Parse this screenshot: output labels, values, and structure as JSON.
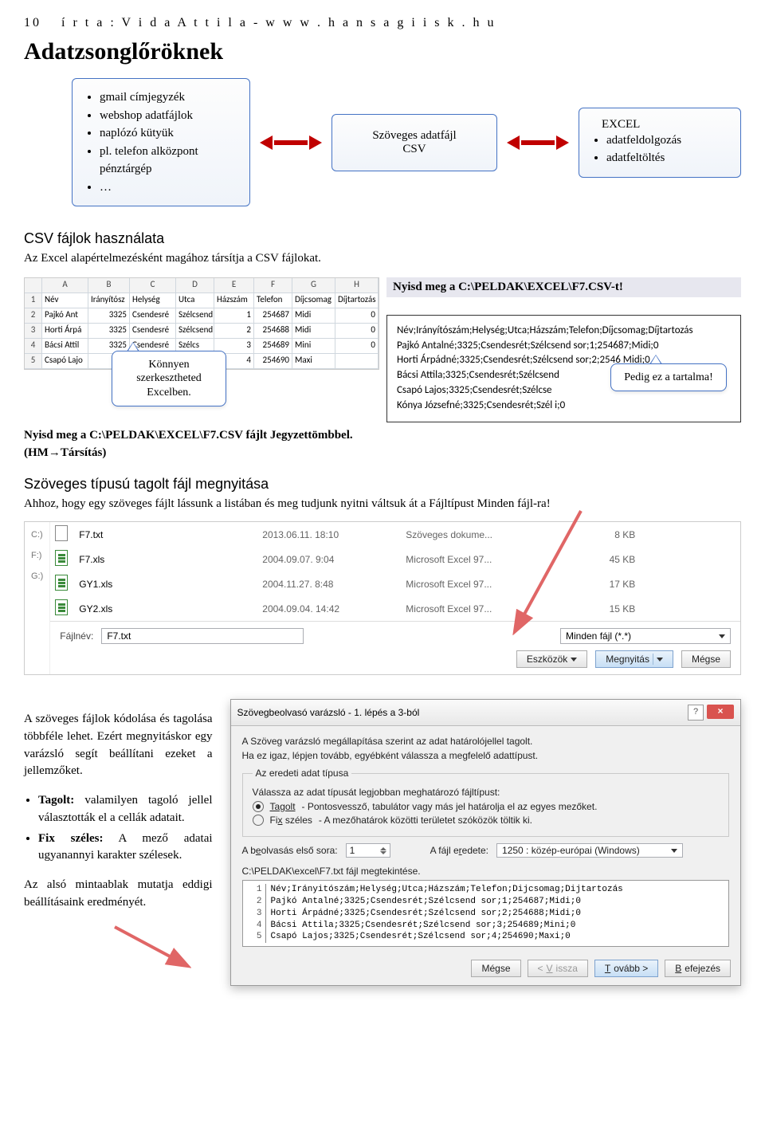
{
  "header": {
    "page_num": "10",
    "author_line": "í r t a : V i d a   A t t i l a   -   w w w . h a n s a g i i s k . h u"
  },
  "title": "Adatzsonglőröknek",
  "diagram": {
    "left_items": [
      "gmail címjegyzék",
      "webshop adatfájlok",
      "naplózó kütyük",
      "pl. telefon alközpont pénztárgép",
      "…"
    ],
    "center_line1": "Szöveges adatfájl",
    "center_line2": "CSV",
    "right_title": "EXCEL",
    "right_items": [
      "adatfeldolgozás",
      "adatfeltöltés"
    ]
  },
  "sec1": {
    "hdr": "CSV fájlok használata",
    "text": "Az Excel alapértelmezésként magához társítja a CSV fájlokat."
  },
  "excel": {
    "cols": [
      "",
      "A",
      "B",
      "C",
      "D",
      "E",
      "F",
      "G",
      "H"
    ],
    "rows": [
      [
        "1",
        "Név",
        "Irányítósz",
        "Helység",
        "Utca",
        "Házszám",
        "Telefon",
        "Díjcsomag",
        "Díjtartozás"
      ],
      [
        "2",
        "Pajkó Ant",
        "3325",
        "Csendesré",
        "Szélcsend",
        "1",
        "254687",
        "Midi",
        "0"
      ],
      [
        "3",
        "Horti Árpá",
        "3325",
        "Csendesré",
        "Szélcsend",
        "2",
        "254688",
        "Midi",
        "0"
      ],
      [
        "4",
        "Bácsi Attil",
        "3325",
        "Csendesré",
        "Szélcs",
        "3",
        "254689",
        "Mini",
        "0"
      ],
      [
        "5",
        "Csapó Lajo",
        "332",
        "",
        "",
        "4",
        "254690",
        "Maxi",
        ""
      ]
    ]
  },
  "callout_excel": "Könnyen szerkesztheted Excelben.",
  "left_open_line": "Nyisd meg a C:\\PELDAK\\EXCEL\\F7.CSV fájlt Jegyzettömbbel. (HM→Társítás)",
  "right_banner": "Nyisd meg a C:\\PELDAK\\EXCEL\\F7.CSV-t!",
  "csv_lines": [
    "Név;Irányítószám;Helység;Utca;Házszám;Telefon;Díjcsomag;Díjtartozás",
    "Pajkó Antalné;3325;Csendesrét;Szélcsend sor;1;254687;Midi;0",
    "Horti Árpádné;3325;Csendesrét;Szélcsend sor;2;2546     Midi;0",
    "Bácsi Attila;3325;Csendesrét;Szélcsend",
    "Csapó Lajos;3325;Csendesrét;Szélcse",
    "Kónya Józsefné;3325;Csendesrét;Szél                                        i;0"
  ],
  "callout_content": "Pedig ez a tartalma!",
  "sec2": {
    "hdr": "Szöveges típusú tagolt fájl megnyitása",
    "text": "Ahhoz, hogy egy szöveges fájlt lássunk a listában és meg tudjunk nyitni váltsuk át a Fájltípust Minden fájl-ra!"
  },
  "file_dialog": {
    "drives": [
      "C:)",
      "F:)",
      "G:)"
    ],
    "files": [
      {
        "icon": "txt",
        "name": "F7.txt",
        "date": "2013.06.11. 18:10",
        "type": "Szöveges dokume...",
        "size": "8 KB"
      },
      {
        "icon": "xls",
        "name": "F7.xls",
        "date": "2004.09.07. 9:04",
        "type": "Microsoft Excel 97...",
        "size": "45 KB"
      },
      {
        "icon": "xls",
        "name": "GY1.xls",
        "date": "2004.11.27. 8:48",
        "type": "Microsoft Excel 97...",
        "size": "17 KB"
      },
      {
        "icon": "xls",
        "name": "GY2.xls",
        "date": "2004.09.04. 14:42",
        "type": "Microsoft Excel 97...",
        "size": "15 KB"
      }
    ],
    "fname_label": "Fájlnév:",
    "fname_value": "F7.txt",
    "filter_value": "Minden fájl (*.*)",
    "tools": "Eszközök",
    "open": "Megnyitás",
    "cancel": "Mégse"
  },
  "wizard_side": {
    "p1": "A szöveges fájlok kódolása és tagolása többféle lehet. Ezért megnyitáskor egy varázsló segít beállítani ezeket a jellemzőket.",
    "items": [
      {
        "b": "Tagolt:",
        "t": " valamilyen tagoló jellel választották el a cellák adatait."
      },
      {
        "b": "Fix széles:",
        "t": " A mező adatai ugyanannyi karakter szélesek."
      }
    ],
    "p2": "Az alsó mintaablak mutatja eddigi beállításaink eredményét."
  },
  "wizard": {
    "title": "Szövegbeolvasó varázsló - 1. lépés a 3-ból",
    "intro1": "A Szöveg varázsló megállapítása szerint az adat határolójellel tagolt.",
    "intro2": "Ha ez igaz, lépjen tovább, egyébként válassza a megfelelő adattípust.",
    "group1_legend": "Az eredeti adat típusa",
    "group1_sub": "Válassza az adat típusát legjobban meghatározó fájltípust:",
    "opt1_label": "Tagolt",
    "opt1_desc": "- Pontosvessző, tabulátor vagy más jel határolja el az egyes mezőket.",
    "opt2_label": "Fix széles",
    "opt2_desc": "- A mezőhatárok közötti területet szóközök töltik ki.",
    "row_label1": "A beolvasás első sora:",
    "row_value": "1",
    "enc_label": "A fájl eredete:",
    "enc_value": "1250 : közép-európai (Windows)",
    "preview_caption": "C:\\PELDAK\\excel\\F7.txt fájl megtekintése.",
    "preview_lines": [
      "Név;Irányitószám;Helység;Utca;Házszám;Telefon;Dijcsomag;Dijtartozás",
      "Pajkó Antalné;3325;Csendesrét;Szélcsend sor;1;254687;Midi;0",
      "Horti Árpádné;3325;Csendesrét;Szélcsend sor;2;254688;Midi;0",
      "Bácsi Attila;3325;Csendesrét;Szélcsend sor;3;254689;Mini;0",
      "Csapó Lajos;3325;Csendesrét;Szélcsend sor;4;254690;Maxi;0"
    ],
    "btn_cancel": "Mégse",
    "btn_back": "< Vissza",
    "btn_next": "Tovább >",
    "btn_finish": "Befejezés"
  }
}
